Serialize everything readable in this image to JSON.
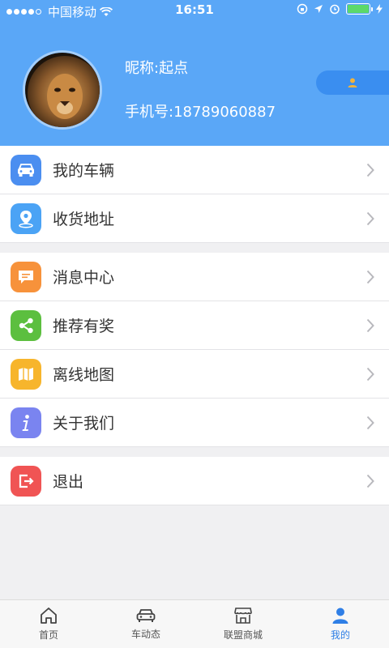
{
  "status_bar": {
    "carrier": "中国移动",
    "time": "16:51"
  },
  "profile": {
    "nickname": "昵称:起点",
    "phone": "手机号:18789060887"
  },
  "menu_group_1": [
    {
      "label": "我的车辆",
      "icon": "car-icon",
      "color": "#4b8ef0"
    },
    {
      "label": "收货地址",
      "icon": "location-pin-icon",
      "color": "#4ba3f5"
    }
  ],
  "menu_group_2": [
    {
      "label": "消息中心",
      "icon": "message-icon",
      "color": "#f7923b"
    },
    {
      "label": "推荐有奖",
      "icon": "share-icon",
      "color": "#5cbf3f"
    },
    {
      "label": "离线地图",
      "icon": "map-icon",
      "color": "#f7b52c"
    },
    {
      "label": "关于我们",
      "icon": "info-icon",
      "color": "#7a84f0"
    }
  ],
  "menu_group_3": [
    {
      "label": "退出",
      "icon": "logout-icon",
      "color": "#f05454"
    }
  ],
  "tabs": [
    {
      "label": "首页",
      "icon": "home-icon"
    },
    {
      "label": "车动态",
      "icon": "car-icon"
    },
    {
      "label": "联盟商城",
      "icon": "store-icon"
    },
    {
      "label": "我的",
      "icon": "user-icon"
    }
  ],
  "colors": {
    "header": "#5aa7f7",
    "active_tab": "#2f7fe6"
  }
}
